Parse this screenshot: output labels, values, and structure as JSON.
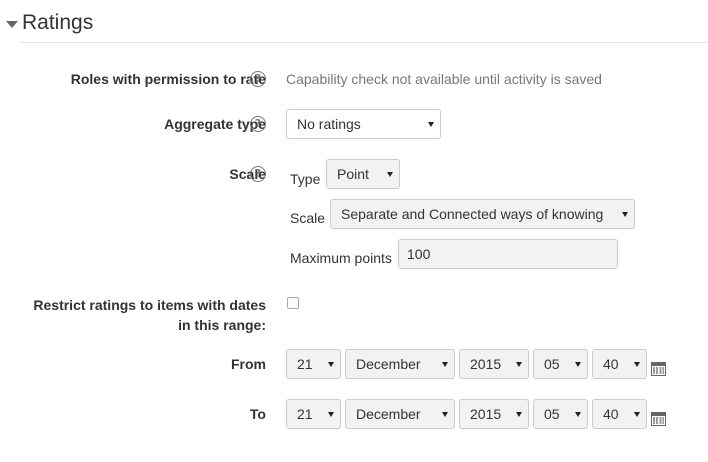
{
  "section": {
    "title": "Ratings"
  },
  "roles": {
    "label": "Roles with permission to rate",
    "value": "Capability check not available until activity is saved"
  },
  "aggregate": {
    "label": "Aggregate type",
    "selected": "No ratings"
  },
  "scale": {
    "label": "Scale",
    "type_label": "Type",
    "type_selected": "Point",
    "scale_label": "Scale",
    "scale_selected": "Separate and Connected ways of knowing",
    "max_label": "Maximum points",
    "max_value": "100"
  },
  "restrict": {
    "label_line1": "Restrict ratings to items with dates",
    "label_line2": "in this range:",
    "checked": false
  },
  "from": {
    "label": "From",
    "day": "21",
    "month": "December",
    "year": "2015",
    "hour": "05",
    "minute": "40"
  },
  "to": {
    "label": "To",
    "day": "21",
    "month": "December",
    "year": "2015",
    "hour": "05",
    "minute": "40"
  },
  "icons": {
    "help": "question-circle-icon",
    "calendar": "calendar-icon",
    "collapse": "caret-down-icon"
  },
  "colors": {
    "text": "#333333",
    "muted": "#777777",
    "border": "#cccccc",
    "disabled_bg": "#f2f2f2"
  }
}
